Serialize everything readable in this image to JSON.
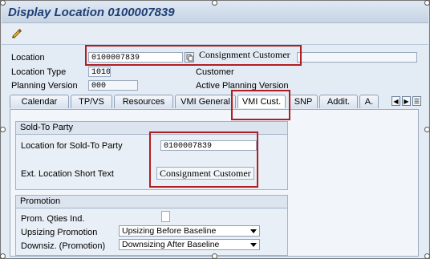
{
  "window": {
    "title": "Display Location 0100007839"
  },
  "toolbar": {
    "edit_icon": "pencil-icon"
  },
  "header": {
    "location_label": "Location",
    "location_value": "0100007839",
    "location_desc": "Consignment Customer",
    "location_type_label": "Location Type",
    "location_type_value": "1010",
    "location_type_desc": "Customer",
    "planning_version_label": "Planning Version",
    "planning_version_value": "000",
    "planning_version_desc": "Active Planning Version"
  },
  "tabs": [
    {
      "label": "Calendar"
    },
    {
      "label": "TP/VS"
    },
    {
      "label": "Resources"
    },
    {
      "label": "VMI General"
    },
    {
      "label": "VMI Cust.",
      "active": true
    },
    {
      "label": "SNP"
    },
    {
      "label": "Addit."
    },
    {
      "label": "A."
    }
  ],
  "sold_to_party": {
    "title": "Sold-To Party",
    "location_label": "Location for Sold-To Party",
    "location_value": "0100007839",
    "short_text_label": "Ext. Location Short Text",
    "short_text_value": "Consignment Customer"
  },
  "promotion": {
    "title": "Promotion",
    "qties_label": "Prom. Qties Ind.",
    "upsizing_label": "Upsizing Promotion",
    "upsizing_value": "Upsizing Before Baseline",
    "downsizing_label": "Downsiz. (Promotion)",
    "downsizing_value": "Downsizing After Baseline"
  },
  "colors": {
    "highlight": "#b01e23",
    "title": "#1d3f74"
  }
}
